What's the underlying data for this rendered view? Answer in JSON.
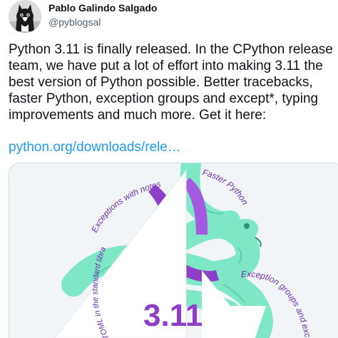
{
  "author": {
    "name": "Pablo Galindo Salgado",
    "handle": "@pyblogsal"
  },
  "tweet": {
    "text": "Python 3.11 is finally released. In the CPython release team, we have put a lot of effort into making 3.11 the best version of Python possible. Better tracebacks, faster Python, exception groups and except*, typing improvements and much more. Get it here:",
    "link_text": "python.org/downloads/rele…"
  },
  "media": {
    "version_label": "3.11",
    "label_exceptions_with_notes": "Exceptions with notes",
    "label_faster_python": "Faster Python",
    "label_toml": "TOML in the standard library",
    "label_exception_groups": "Exception groups and except*"
  },
  "colors": {
    "link": "#1d9bf0",
    "handle": "#536471",
    "snake_mint": "#7ee8c6",
    "purple": "#8e3fc9",
    "label_purple": "#6a2fa8",
    "media_bg": "#f2f5f7"
  }
}
